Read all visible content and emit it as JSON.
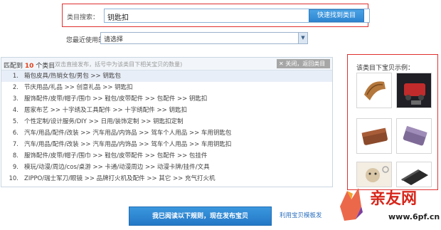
{
  "search": {
    "label": "类目搜索：",
    "value": "钥匙扣",
    "button": "快速找到类目"
  },
  "recent": {
    "label": "您最近使用的类目：",
    "selected": "请选择"
  },
  "results": {
    "title_prefix": "匹配到",
    "count": "10",
    "title_suffix": "个类目",
    "hint": "(双击直接发布，括号中为该类目下相关宝贝的数量)",
    "close_label": "关闭，返回类目",
    "items": [
      {
        "num": "1.",
        "path": "箱包皮具/热销女包/男包 >> 钥匙包"
      },
      {
        "num": "2.",
        "path": "节庆用品/礼品 >> 创意礼品 >> 钥匙扣"
      },
      {
        "num": "3.",
        "path": "服饰配件/皮带/帽子/围巾 >> 鞋包/皮带配件 >> 包配件 >> 钥匙扣"
      },
      {
        "num": "4.",
        "path": "居家布艺 >> 十字绣及工具配件 >> 十字绣配件 >> 钥匙扣"
      },
      {
        "num": "5.",
        "path": "个性定制/设计服务/DIY >> 日用/装饰定制 >> 钥匙扣定制"
      },
      {
        "num": "6.",
        "path": "汽车/用品/配件/改装 >> 汽车用品/内饰品 >> 驾车个人用品 >> 车用钥匙包"
      },
      {
        "num": "7.",
        "path": "汽车/用品/配件/改装 >> 汽车用品/内饰品 >> 驾车个人用品 >> 车用钥匙扣"
      },
      {
        "num": "8.",
        "path": "服饰配件/皮带/帽子/围巾 >> 鞋包/皮带配件 >> 包配件 >> 包挂件"
      },
      {
        "num": "9.",
        "path": "模玩/动漫/周边/cos/桌游 >> 卡通/动漫周边 >> 动漫卡牌/挂件/文具"
      },
      {
        "num": "10.",
        "path": "ZIPPO/瑞士军刀/眼镜 >> 品牌打火机及配件 >> 其它 >> 充气打火机"
      }
    ]
  },
  "sample": {
    "title": "该类目下宝贝示例："
  },
  "bottom": {
    "publish_button": "我已阅读以下规则，现在发布宝贝",
    "template_link": "利用宝贝模板发"
  },
  "watermark": {
    "brand": "亲友网",
    "url": "www.6pf.cn"
  },
  "colors": {
    "accent_red": "#e0302f",
    "button_blue": "#2e86d2",
    "count_orange": "#e3401a"
  }
}
